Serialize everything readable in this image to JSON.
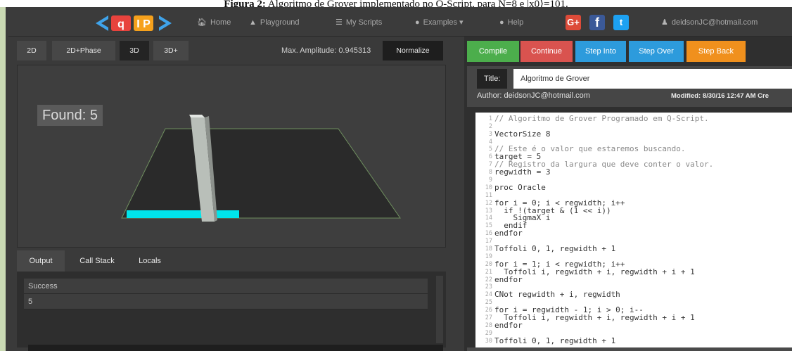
{
  "caption": {
    "bold": "Figura 2:",
    "text": " Algoritmo de Grover implementado no Q-Script, para N=8 e |x0⟩=101."
  },
  "navbar": {
    "logo_text": "<qIP>",
    "items": [
      {
        "label": "Home",
        "icon": "home-icon",
        "glyph": "🏠︎"
      },
      {
        "label": "Playground",
        "icon": "flask-icon",
        "glyph": "▲"
      },
      {
        "label": "My Scripts",
        "icon": "list-icon",
        "glyph": "☰"
      },
      {
        "label": "Examples",
        "icon": "circle-arrow-icon",
        "glyph": "●"
      },
      {
        "label": "Help",
        "icon": "info-icon",
        "glyph": "●"
      }
    ],
    "examples_caret": "▾",
    "social": {
      "google": "G+",
      "facebook": "f",
      "twitter": "t"
    },
    "user": "deidsonJC@hotmail.com"
  },
  "view_tabs": [
    "2D",
    "2D+Phase",
    "3D",
    "3D+"
  ],
  "active_view_tab": "3D",
  "max_amplitude": "Max. Amplitude: 0.945313",
  "normalize_label": "Normalize",
  "found_label": "Found: 5",
  "output_tabs": [
    "Output",
    "Call Stack",
    "Locals"
  ],
  "output_rows": [
    "Success",
    "5"
  ],
  "toolbar": {
    "compile": "Compile",
    "continue": "Continue",
    "step_into": "Step Into",
    "step_over": "Step Over",
    "step_back": "Step Back"
  },
  "colors": {
    "compile": "#4cae4c",
    "continue": "#d9534f",
    "step_into": "#2d9bdc",
    "step_over": "#2d9bdc",
    "step_back": "#f0901d",
    "cyan_bar": "#00e5ea"
  },
  "script": {
    "title_label": "Title:",
    "title": "Algoritmo de Grover",
    "author": "Author: deidsonJC@hotmail.com",
    "modified": "Modified: 8/30/16 12:47 AM   Cre"
  },
  "code_lines": [
    "// Algoritmo de Grover Programado em Q-Script.",
    "",
    "VectorSize 8",
    "",
    "// Este é o valor que estaremos buscando.",
    "target = 5",
    "// Registro da largura que deve conter o valor.",
    "regwidth = 3",
    "",
    "proc Oracle",
    "",
    "for i = 0; i < regwidth; i++",
    "  if !(target & (1 << i))",
    "    SigmaX i",
    "  endif",
    "endfor",
    "",
    "Toffoli 0, 1, regwidth + 1",
    "",
    "for i = 1; i < regwidth; i++",
    "  Toffoli i, regwidth + i, regwidth + i + 1",
    "endfor",
    "",
    "CNot regwidth + i, regwidth",
    "",
    "for i = regwidth - 1; i > 0; i--",
    "  Toffoli i, regwidth + i, regwidth + i + 1",
    "endfor",
    "",
    "Toffoli 0, 1, regwidth + 1"
  ],
  "code_line_numbers": [
    "1",
    "2",
    "3",
    "4",
    "5",
    "6",
    "7",
    "8",
    "9",
    "10",
    "11",
    "12",
    "13",
    "14",
    "15",
    "16",
    "17",
    "18",
    "19",
    "20",
    "21",
    "22",
    "23",
    "24",
    "25",
    "26",
    "27",
    "28",
    "29",
    "30"
  ]
}
